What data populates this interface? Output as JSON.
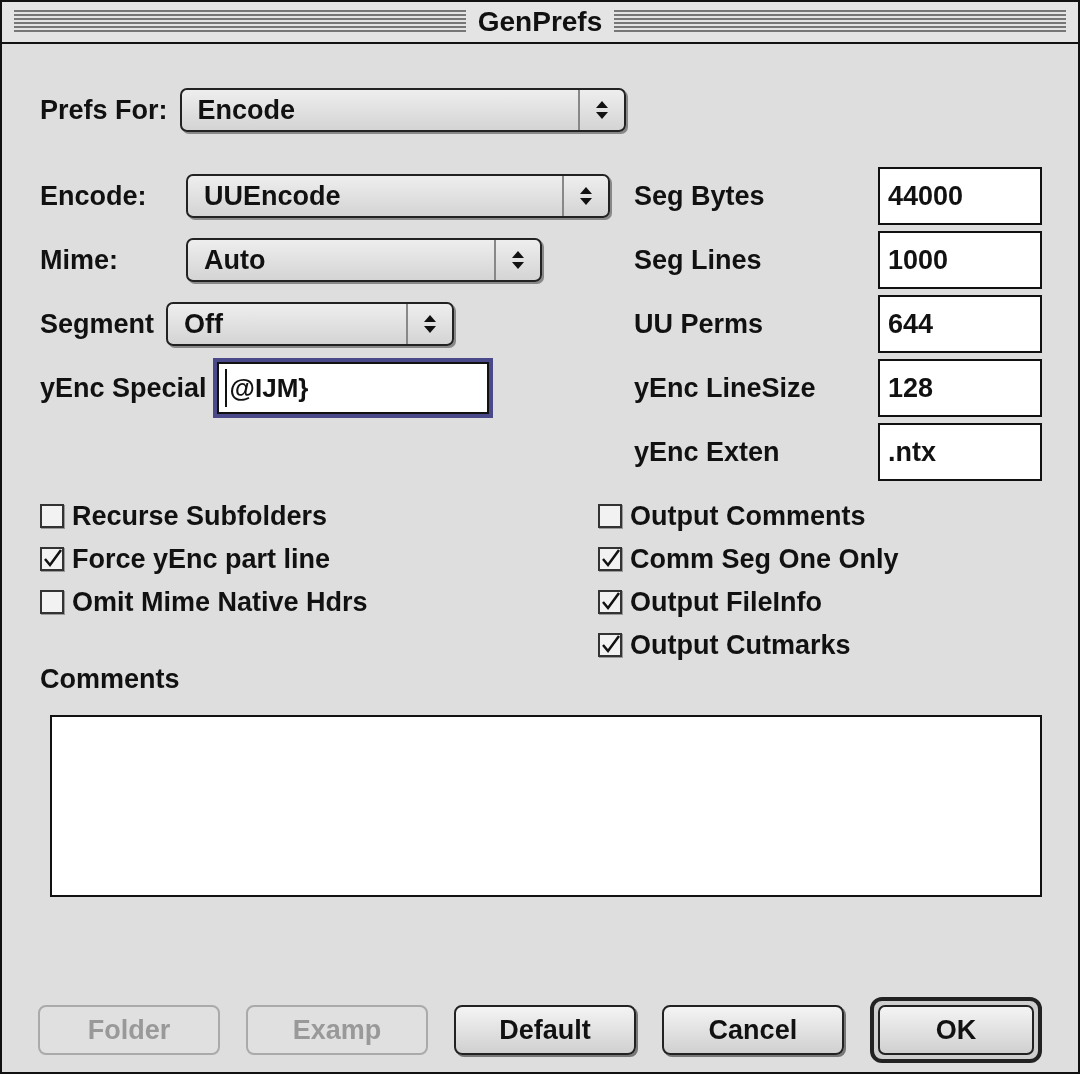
{
  "window": {
    "title": "GenPrefs"
  },
  "prefs_for": {
    "label": "Prefs For:",
    "value": "Encode"
  },
  "popups": [
    {
      "label": "Encode:",
      "value": "UUEncode"
    },
    {
      "label": "Mime:",
      "value": "Auto"
    },
    {
      "label": "Segment",
      "value": "Off"
    }
  ],
  "special": {
    "label": "yEnc Special",
    "value": "@IJM}",
    "focused": true
  },
  "fields": [
    {
      "label": "Seg Bytes",
      "value": "44000"
    },
    {
      "label": "Seg Lines",
      "value": "1000"
    },
    {
      "label": "UU Perms",
      "value": "644"
    },
    {
      "label": "yEnc LineSize",
      "value": "128"
    },
    {
      "label": "yEnc Exten",
      "value": ".ntx"
    }
  ],
  "checkboxes_left": [
    {
      "label": "Recurse Subfolders",
      "checked": false
    },
    {
      "label": "Force yEnc part line",
      "checked": true
    },
    {
      "label": "Omit Mime Native Hdrs",
      "checked": false
    }
  ],
  "checkboxes_right": [
    {
      "label": "Output Comments",
      "checked": false
    },
    {
      "label": "Comm Seg One Only",
      "checked": true
    },
    {
      "label": "Output FileInfo",
      "checked": true
    },
    {
      "label": "Output Cutmarks",
      "checked": true
    }
  ],
  "comments": {
    "label": "Comments"
  },
  "buttons": [
    {
      "label": "Folder",
      "disabled": true,
      "default": false
    },
    {
      "label": "Examp",
      "disabled": true,
      "default": false
    },
    {
      "label": "Default",
      "disabled": false,
      "default": false
    },
    {
      "label": "Cancel",
      "disabled": false,
      "default": false
    },
    {
      "label": "OK",
      "disabled": false,
      "default": true
    }
  ]
}
